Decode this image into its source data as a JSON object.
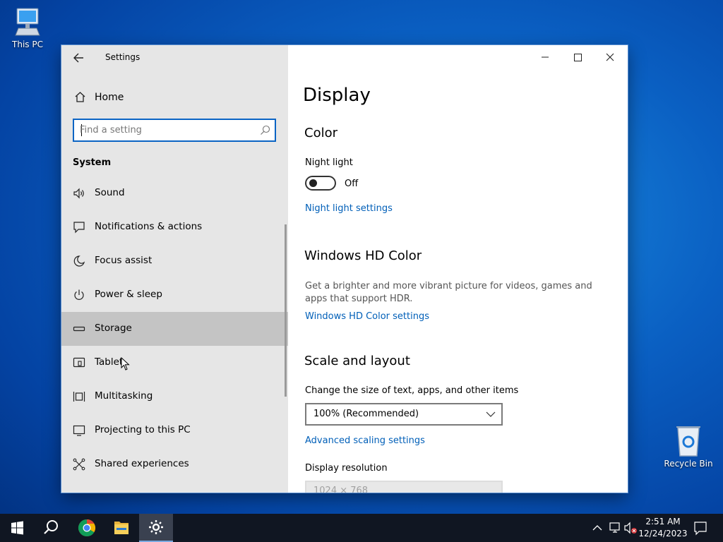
{
  "desktop": {
    "this_pc_label": "This PC",
    "recycle_bin_label": "Recycle Bin"
  },
  "window": {
    "title": "Settings",
    "sidebar": {
      "home_label": "Home",
      "search_placeholder": "Find a setting",
      "section_title": "System",
      "items": [
        {
          "label": "Sound",
          "icon": "speaker-icon"
        },
        {
          "label": "Notifications & actions",
          "icon": "notification-icon"
        },
        {
          "label": "Focus assist",
          "icon": "moon-icon"
        },
        {
          "label": "Power & sleep",
          "icon": "power-icon"
        },
        {
          "label": "Storage",
          "icon": "storage-icon",
          "selected": true
        },
        {
          "label": "Tablet",
          "icon": "tablet-icon"
        },
        {
          "label": "Multitasking",
          "icon": "multitasking-icon"
        },
        {
          "label": "Projecting to this PC",
          "icon": "projecting-icon"
        },
        {
          "label": "Shared experiences",
          "icon": "shared-experiences-icon"
        }
      ]
    },
    "main": {
      "page_title": "Display",
      "color": {
        "heading": "Color",
        "night_light_label": "Night light",
        "night_light_state": "Off",
        "night_light_settings_link": "Night light settings"
      },
      "hd_color": {
        "heading": "Windows HD Color",
        "description": "Get a brighter and more vibrant picture for videos, games and apps that support HDR.",
        "settings_link": "Windows HD Color settings"
      },
      "scale_layout": {
        "heading": "Scale and layout",
        "size_label": "Change the size of text, apps, and other items",
        "size_value": "100% (Recommended)",
        "advanced_link": "Advanced scaling settings",
        "resolution_label": "Display resolution",
        "resolution_value": "1024 × 768"
      }
    }
  },
  "taskbar": {
    "time": "2:51 AM",
    "date": "12/24/2023"
  },
  "colors": {
    "accent": "#0a64c4",
    "link": "#005fb8",
    "sidebar_bg": "#e6e6e6",
    "selected_bg": "#c4c4c4",
    "taskbar_bg": "#101622"
  }
}
